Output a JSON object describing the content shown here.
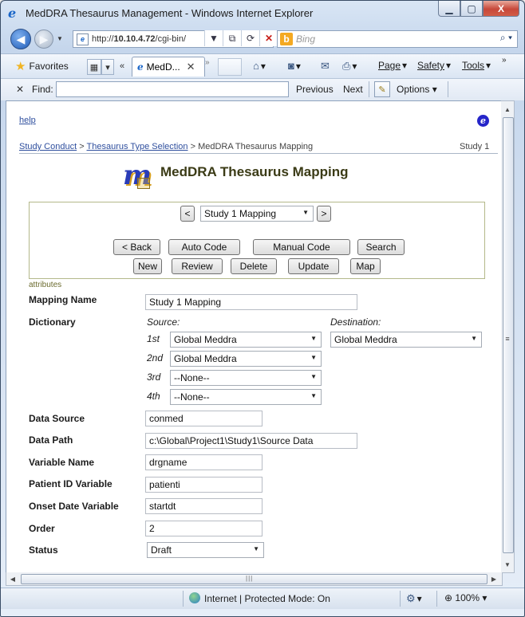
{
  "window": {
    "title": "MedDRA Thesaurus Management - Windows Internet Explorer",
    "min_glyph": "▁",
    "max_glyph": "▢",
    "close_glyph": "X"
  },
  "browser": {
    "address": "http://10.10.4.72/cgi-bin/",
    "address_bold_part": "10.10.4.72",
    "address_prefix": "http://",
    "address_suffix": "/cgi-bin/",
    "search_placeholder": "Bing",
    "favorites_label": "Favorites",
    "tab_label": "MedD...",
    "menu": {
      "page": "Page",
      "safety": "Safety",
      "tools": "Tools"
    },
    "find": {
      "label": "Find:",
      "value": "",
      "previous": "Previous",
      "next": "Next",
      "options": "Options"
    },
    "status": {
      "zone": "Internet | Protected Mode: On",
      "zoom": "100%"
    }
  },
  "page": {
    "help_link": "help",
    "breadcrumb": [
      {
        "label": "Study Conduct",
        "link": true
      },
      {
        "label": "Thesaurus Type Selection",
        "link": true
      },
      {
        "label": "MedDRA Thesaurus Mapping",
        "link": false
      }
    ],
    "breadcrumb_sep": ">",
    "breadcrumb_right": "Study 1",
    "logo_letter": "m",
    "title": "MedDRA Thesaurus Mapping",
    "record_selector": {
      "prev": "<",
      "next": ">",
      "value": "Study 1 Mapping"
    },
    "buttons_row1": {
      "back": "< Back",
      "auto_code": "Auto Code",
      "manual_code": "Manual Code",
      "search": "Search"
    },
    "buttons_row2": {
      "new": "New",
      "review": "Review",
      "delete": "Delete",
      "update": "Update",
      "map": "Map"
    },
    "attributes_label": "attributes",
    "fields": {
      "mapping_name": {
        "label": "Mapping Name",
        "value": "Study 1 Mapping"
      },
      "dictionary": {
        "label": "Dictionary",
        "source_label": "Source:",
        "destination_label": "Destination:",
        "rows": [
          {
            "ordinal": "1st",
            "value": "Global Meddra"
          },
          {
            "ordinal": "2nd",
            "value": "Global Meddra"
          },
          {
            "ordinal": "3rd",
            "value": "--None--"
          },
          {
            "ordinal": "4th",
            "value": "--None--"
          }
        ],
        "destination_value": "Global Meddra"
      },
      "data_source": {
        "label": "Data Source",
        "value": "conmed"
      },
      "data_path": {
        "label": "Data Path",
        "value": "c:\\Global\\Project1\\Study1\\Source Data"
      },
      "variable_name": {
        "label": "Variable Name",
        "value": "drgname"
      },
      "patient_id_variable": {
        "label": "Patient ID Variable",
        "value": "patienti"
      },
      "onset_date_variable": {
        "label": "Onset Date Variable",
        "value": "startdt"
      },
      "order": {
        "label": "Order",
        "value": "2"
      },
      "status": {
        "label": "Status",
        "value": "Draft"
      }
    }
  },
  "colors": {
    "link": "#2f4f9e",
    "title_text": "#3b3b16",
    "panel_border": "#b4b88a",
    "close_button": "#c7483a"
  }
}
